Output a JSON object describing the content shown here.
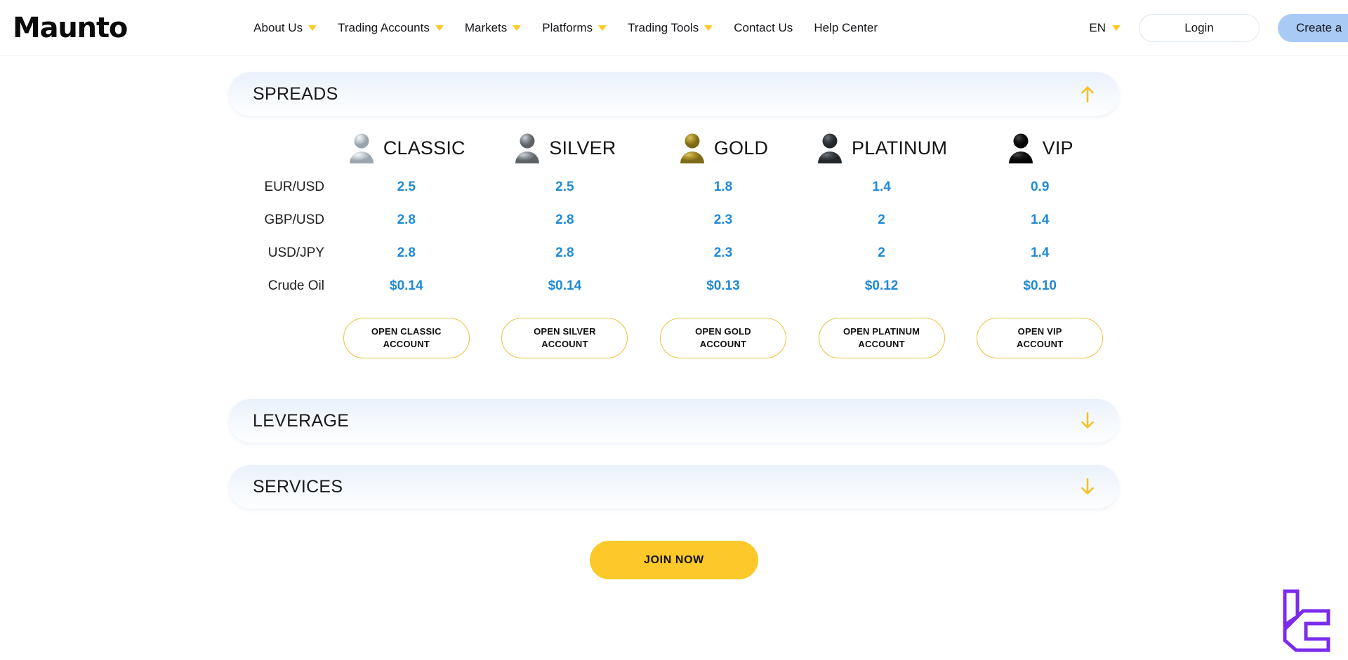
{
  "navbar": {
    "brand": "Maunto",
    "links": [
      {
        "label": "About Us",
        "has_caret": true
      },
      {
        "label": "Trading Accounts",
        "has_caret": true
      },
      {
        "label": "Markets",
        "has_caret": true
      },
      {
        "label": "Platforms",
        "has_caret": true
      },
      {
        "label": "Trading Tools",
        "has_caret": true
      },
      {
        "label": "Contact Us",
        "has_caret": false
      },
      {
        "label": "Help Center",
        "has_caret": false
      }
    ],
    "language": "EN",
    "login_label": "Login",
    "create_label": "Create a"
  },
  "accordions": {
    "spreads": {
      "title": "SPREADS",
      "state": "expanded",
      "arrow": "arrow-up-icon"
    },
    "leverage": {
      "title": "LEVERAGE",
      "state": "collapsed",
      "arrow": "arrow-down-icon"
    },
    "services": {
      "title": "SERVICES",
      "state": "collapsed",
      "arrow": "arrow-down-icon"
    }
  },
  "tiers": [
    {
      "name": "CLASSIC",
      "icon": "person-icon-silver",
      "button": "OPEN CLASSIC\nACCOUNT",
      "color": "#b9c0c6"
    },
    {
      "name": "SILVER",
      "icon": "person-icon-gray",
      "button": "OPEN SILVER\nACCOUNT",
      "color": "#7d8488"
    },
    {
      "name": "GOLD",
      "icon": "person-icon-gold",
      "button": "OPEN GOLD\nACCOUNT",
      "color": "#a18827"
    },
    {
      "name": "PLATINUM",
      "icon": "person-icon-darkgray",
      "button": "OPEN PLATINUM\nACCOUNT",
      "color": "#3b3f42"
    },
    {
      "name": "VIP",
      "icon": "person-icon-black",
      "button": "OPEN VIP\nACCOUNT",
      "color": "#141414"
    }
  ],
  "buttons": {
    "classic": "OPEN CLASSIC ACCOUNT",
    "silver": "OPEN SILVER ACCOUNT",
    "gold": "OPEN GOLD ACCOUNT",
    "platinum": "OPEN PLATINUM ACCOUNT",
    "vip": "OPEN VIP ACCOUNT"
  },
  "cta": {
    "join_label": "JOIN NOW"
  },
  "colors": {
    "value_blue": "#1f8ad6",
    "accent_yellow": "#FDC82A",
    "button_border": "#e8c23f",
    "create_button": "#a8caf5",
    "watermark_purple": "#7B2CEB"
  },
  "chart_data": {
    "type": "table",
    "title": "SPREADS",
    "columns": [
      "",
      "CLASSIC",
      "SILVER",
      "GOLD",
      "PLATINUM",
      "VIP"
    ],
    "rows": [
      {
        "instrument": "EUR/USD",
        "values": [
          "2.5",
          "2.5",
          "1.8",
          "1.4",
          "0.9"
        ]
      },
      {
        "instrument": "GBP/USD",
        "values": [
          "2.8",
          "2.8",
          "2.3",
          "2",
          "1.4"
        ]
      },
      {
        "instrument": "USD/JPY",
        "values": [
          "2.8",
          "2.8",
          "2.3",
          "2",
          "1.4"
        ]
      },
      {
        "instrument": "Crude Oil",
        "values": [
          "$0.14",
          "$0.14",
          "$0.13",
          "$0.12",
          "$0.10"
        ]
      }
    ]
  }
}
